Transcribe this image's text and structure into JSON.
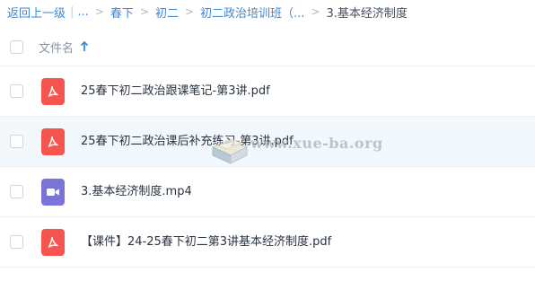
{
  "breadcrumb": {
    "back_label": "返回上一级",
    "ellipsis": "...",
    "items": [
      "春下",
      "初二",
      "初二政治培训班（..."
    ],
    "current": "3.基本经济制度"
  },
  "list_header": {
    "name_label": "文件名",
    "sort_icon": "arrow-up-icon"
  },
  "files": [
    {
      "name": "25春下初二政治跟课笔记-第3讲.pdf",
      "type": "pdf",
      "icon": "pdf-file-icon"
    },
    {
      "name": "25春下初二政治课后补充练习-第3讲.pdf",
      "type": "pdf",
      "icon": "pdf-file-icon"
    },
    {
      "name": "3.基本经济制度.mp4",
      "type": "video",
      "icon": "video-file-icon"
    },
    {
      "name": "【课件】24-25春下初二第3讲基本经济制度.pdf",
      "type": "pdf",
      "icon": "pdf-file-icon"
    }
  ],
  "watermark": {
    "text": "www.xue-ba.org"
  },
  "colors": {
    "link": "#3f88d6",
    "pdf_icon": "#f5544f",
    "video_icon": "#7b74d8",
    "row_highlight": "#f3f8fd"
  }
}
